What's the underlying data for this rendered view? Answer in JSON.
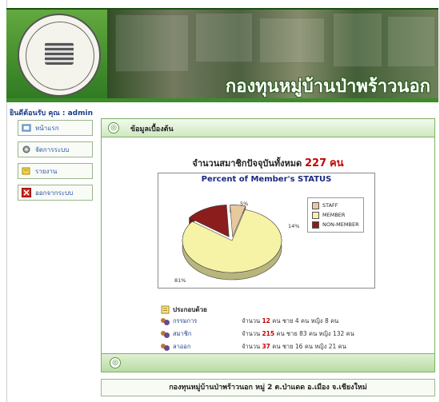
{
  "header": {
    "banner_text": "กองทุนหมู่บ้านป่าพร้าวนอก",
    "logo_icon": "fund-seal-icon"
  },
  "sidebar": {
    "welcome": "ยินดีต้อนรับ คุณ : admin",
    "items": [
      {
        "label": "หน้าแรก",
        "icon": "home-icon"
      },
      {
        "label": "จัดการระบบ",
        "icon": "gear-icon"
      },
      {
        "label": "รายงาน",
        "icon": "report-icon"
      },
      {
        "label": "ออกจากระบบ",
        "icon": "logout-icon"
      }
    ]
  },
  "main": {
    "section_title": "ข้อมูลเบื้องต้น",
    "total_prefix": "จำนวนสมาชิกปัจจุบันทั้งหมด",
    "total_count": "227",
    "total_unit": "คน",
    "composition_title": "ประกอบด้วย",
    "composition": [
      {
        "name": "กรรมการ",
        "pre": "จำนวน",
        "count": "12",
        "post": "คน ชาย 4 คน หญิง 8 คน"
      },
      {
        "name": "สมาชิก",
        "pre": "จำนวน",
        "count": "215",
        "post": "คน ชาย 83 คน หญิง 132 คน"
      },
      {
        "name": "ลาออก",
        "pre": "จำนวน",
        "count": "37",
        "post": "คน ชาย 16 คน หญิง 21 คน"
      }
    ],
    "address": "กองทุนหมู่บ้านป่าพร้าวนอก หมู่ 2 ต.ป่าแดด อ.เมือง จ.เชียงใหม่"
  },
  "chart_data": {
    "type": "pie",
    "title": "Percent of Member's STATUS",
    "categories": [
      "STAFF",
      "MEMBER",
      "NON-MEMBER"
    ],
    "values": [
      5,
      81,
      14
    ],
    "labels": [
      "5%",
      "81%",
      "14%"
    ],
    "colors": [
      "#e8c99c",
      "#f7f3a6",
      "#8b1d1d"
    ],
    "legend_position": "right"
  }
}
